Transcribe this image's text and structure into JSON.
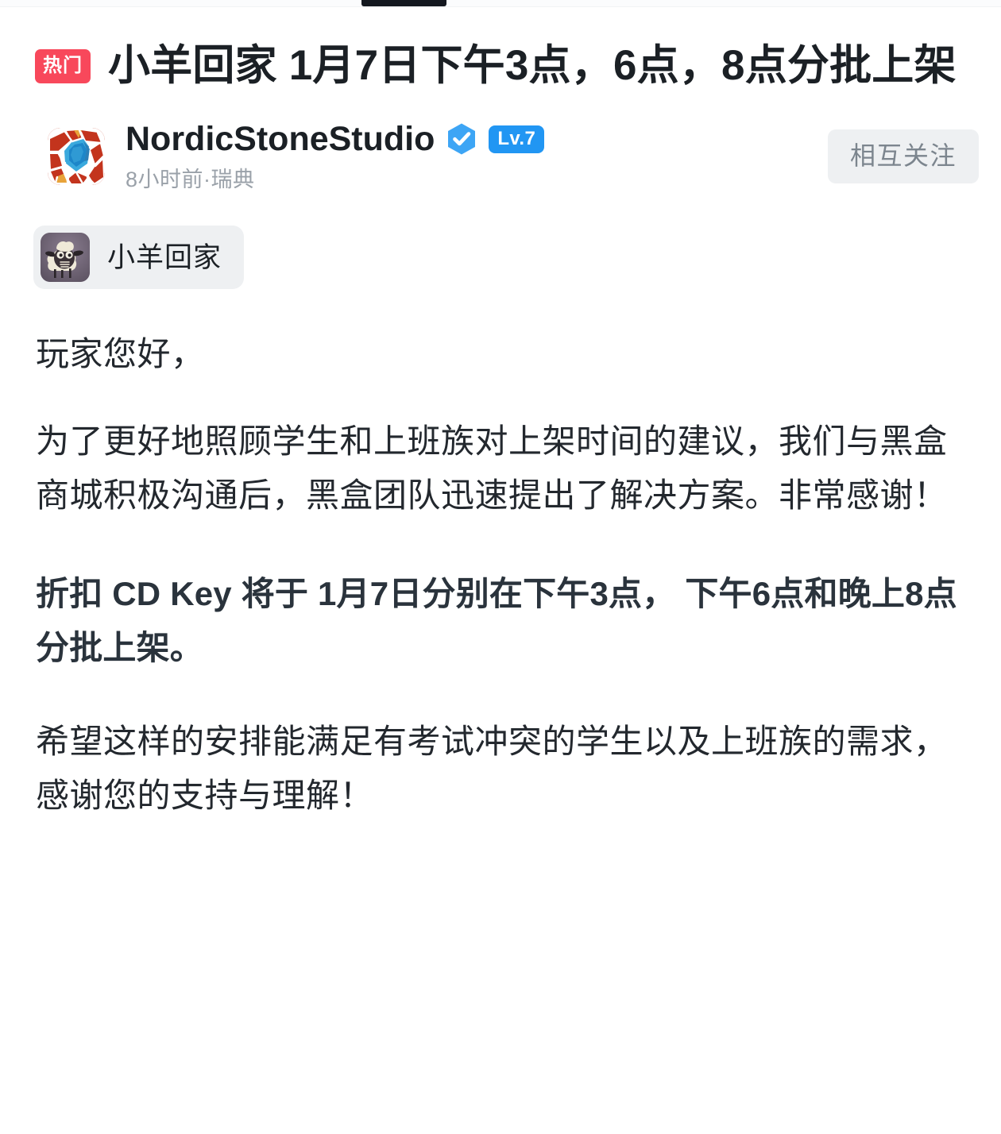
{
  "topbar": {
    "indicator_label": ""
  },
  "post": {
    "hot_badge": "热门",
    "title": "小羊回家  1月7日下午3点，6点，8点分批上架",
    "author": {
      "name": "NordicStoneStudio",
      "verified_icon": "verified-check-icon",
      "level_badge": "Lv.7",
      "meta": "8小时前·瑞典",
      "avatar_icon": "mosaic-gem-avatar-icon"
    },
    "follow_button": "相互关注",
    "game_tag": {
      "label": "小羊回家",
      "icon": "sheep-game-icon"
    },
    "paragraphs": [
      "玩家您好，",
      "为了更好地照顾学生和上班族对上架时间的建议，我们与黑盒商城积极沟通后，黑盒团队迅速提出了解决方案。非常感谢！",
      "折扣 CD Key 将于 1月7日分别在下午3点， 下午6点和晚上8点分批上架。",
      "希望这样的安排能满足有考试冲突的学生以及上班族的需求，感谢您的支持与理解！"
    ]
  },
  "colors": {
    "hot_badge_bg": "#f8485b",
    "verified_blue": "#2196f3",
    "level_badge_bg": "#2196f3",
    "follow_button_bg": "#eef0f2",
    "follow_button_text": "#7c858e",
    "title_text": "#1b2025",
    "body_text": "#23282e",
    "meta_text": "#9aa1a9",
    "page_bg": "#ffffff"
  }
}
